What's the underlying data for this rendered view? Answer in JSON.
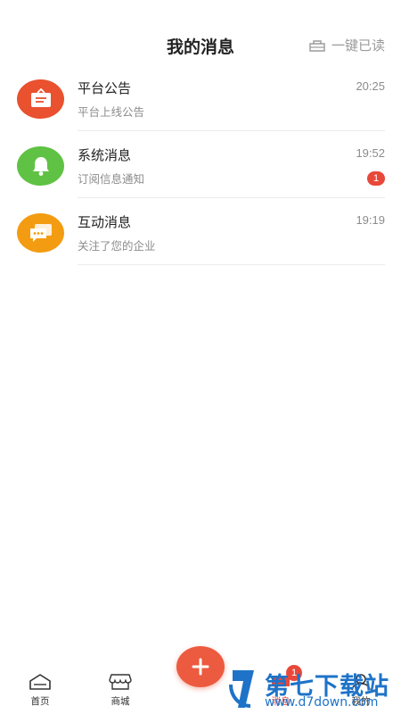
{
  "header": {
    "title": "我的消息",
    "mark_all_read": "一键已读",
    "mark_all_icon": "broom-icon"
  },
  "messages": [
    {
      "title": "平台公告",
      "subtitle": "平台上线公告",
      "time": "20:25",
      "icon": "announcement-board-icon",
      "color": "#e9512f"
    },
    {
      "title": "系统消息",
      "subtitle": "订阅信息通知",
      "time": "19:52",
      "badge": "1",
      "icon": "bell-icon",
      "color": "#5fc244"
    },
    {
      "title": "互动消息",
      "subtitle": "关注了您的企业",
      "time": "19:19",
      "icon": "chat-bubble-icon",
      "color": "#f39c12"
    }
  ],
  "tabbar": {
    "tabs": [
      {
        "label": "首页",
        "icon": "home-icon"
      },
      {
        "label": "商城",
        "icon": "store-icon"
      },
      {
        "label": "消息",
        "icon": "message-icon",
        "badge": "1",
        "active": true
      },
      {
        "label": "我的",
        "icon": "profile-icon"
      }
    ],
    "fab_icon": "plus-icon"
  },
  "watermark": {
    "title": "第七下载站",
    "url": "www.d7down.com"
  },
  "colors": {
    "accent": "#e8483a",
    "text_secondary": "#8c8c8c"
  }
}
